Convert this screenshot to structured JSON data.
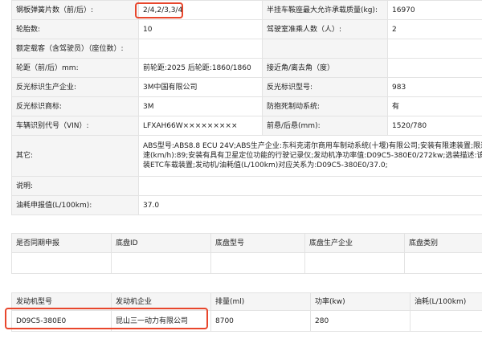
{
  "spec_rows": [
    {
      "l1": "钢板弹簧片数（前/后）:",
      "v1": "2/4,2/3,3/4",
      "l2": "半挂车鞍座最大允许承载质量(kg):",
      "v2": "16970"
    },
    {
      "l1": "轮胎数:",
      "v1": "10",
      "l2": "驾驶室准乘人数（人）:",
      "v2": "2"
    },
    {
      "l1": "额定载客（含驾驶员）（座位数）:",
      "v1": "",
      "l2": "",
      "v2": ""
    },
    {
      "l1": "轮距（前/后）mm:",
      "v1": "前轮距:2025 后轮距:1860/1860",
      "l2": "接近角/离去角（度）",
      "v2": ""
    },
    {
      "l1": "反光标识生产企业:",
      "v1": "3M中国有限公司",
      "l2": "反光标识型号:",
      "v2": "983"
    },
    {
      "l1": "反光标识商标:",
      "v1": "3M",
      "l2": "防抱死制动系统:",
      "v2": "有"
    },
    {
      "l1": "车辆识别代号（VIN）:",
      "v1": "LFXAH66W×××××××××",
      "l2": "前悬/后悬(mm):",
      "v2": "1520/780"
    }
  ],
  "other": {
    "label": "其它:",
    "lines": [
      "ABS型号:ABS8.8 ECU 24V;ABS生产企业:东科克诺尔商用车制动系统(十堰)有限公司;安装有限速装置;限速",
      "速(km/h):89;安装有具有卫星定位功能的行驶记录仪;发动机净功率值:D09C5-380E0/272kw;选装描述:该车型",
      "装ETC车载装置;发动机/油耗值(L/100km)对应关系为:D09C5-380E0/37.0;"
    ]
  },
  "note": {
    "label": "说明:",
    "value": ""
  },
  "fuel": {
    "label": "油耗申报值(L/100km):",
    "value": "37.0"
  },
  "sync_table": {
    "headers": [
      "是否同期申报",
      "底盘ID",
      "底盘型号",
      "底盘生产企业",
      "底盘类别"
    ],
    "row": [
      "",
      "",
      "",
      "",
      ""
    ]
  },
  "engine_table": {
    "headers": [
      "发动机型号",
      "发动机企业",
      "排量(ml)",
      "功率(kw)",
      "油耗(L/100km)"
    ],
    "row": [
      "D09C5-380E0",
      "昆山三一动力有限公司",
      "8700",
      "280",
      ""
    ]
  },
  "colors": {
    "highlight": "#e8462c",
    "label_bg": "#f5f5f5",
    "border": "#e3e3e3"
  }
}
